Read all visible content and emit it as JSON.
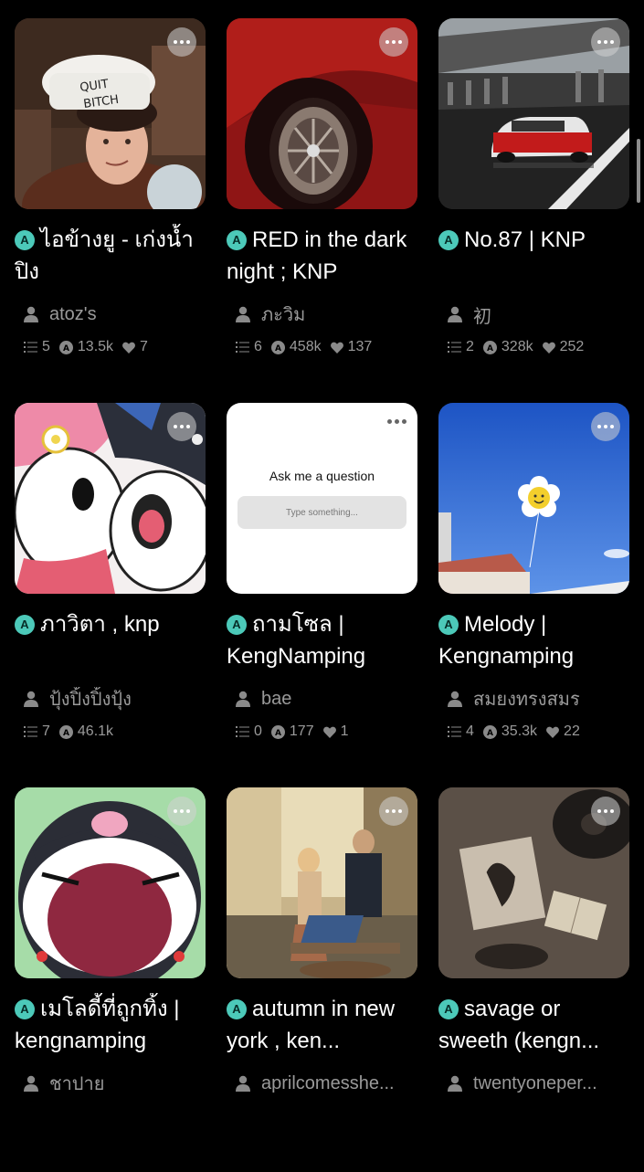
{
  "colors": {
    "background": "#000000",
    "badge": "#4cc9b9",
    "muted_text": "#9a9a9a"
  },
  "cards": [
    {
      "title": "ไอข้างยู - เก่งน้ำปิง",
      "author": "atoz's",
      "parts": "5",
      "reads": "13.5k",
      "likes": "7"
    },
    {
      "title": "RED in the dark night ; KNP",
      "author": "ภะวิม",
      "parts": "6",
      "reads": "458k",
      "likes": "137"
    },
    {
      "title": "No.87 | KNP",
      "author": "初",
      "parts": "2",
      "reads": "328k",
      "likes": "252"
    },
    {
      "title": "ภาวิตา , knp",
      "author": "ปุ้งปิ้งปิ้งปุ้ง",
      "parts": "7",
      "reads": "46.1k",
      "likes": ""
    },
    {
      "title": "ถามโซล | KengNamping",
      "author": "bae",
      "parts": "0",
      "reads": "177",
      "likes": "1",
      "ask_prompt": "Ask me a question",
      "ask_placeholder": "Type something..."
    },
    {
      "title": "Melody | Kengnamping",
      "author": "สมยงทรงสมร",
      "parts": "4",
      "reads": "35.3k",
      "likes": "22"
    },
    {
      "title": "เมโลดี้ที่ถูกทิ้ง | kengnamping",
      "author": "ชาปาย"
    },
    {
      "title": "autumn in new york , ken...",
      "author": "aprilcomesshe..."
    },
    {
      "title": "savage or sweeth (kengn...",
      "author": "twentyoneper..."
    }
  ],
  "thumb_texts": {
    "chef_hat": "QUIT\nBITCH"
  },
  "icons": {
    "badge_letter": "A",
    "more": "more-icon",
    "person": "person-icon",
    "list": "list-icon",
    "reads": "reads-icon",
    "heart": "heart-icon"
  }
}
